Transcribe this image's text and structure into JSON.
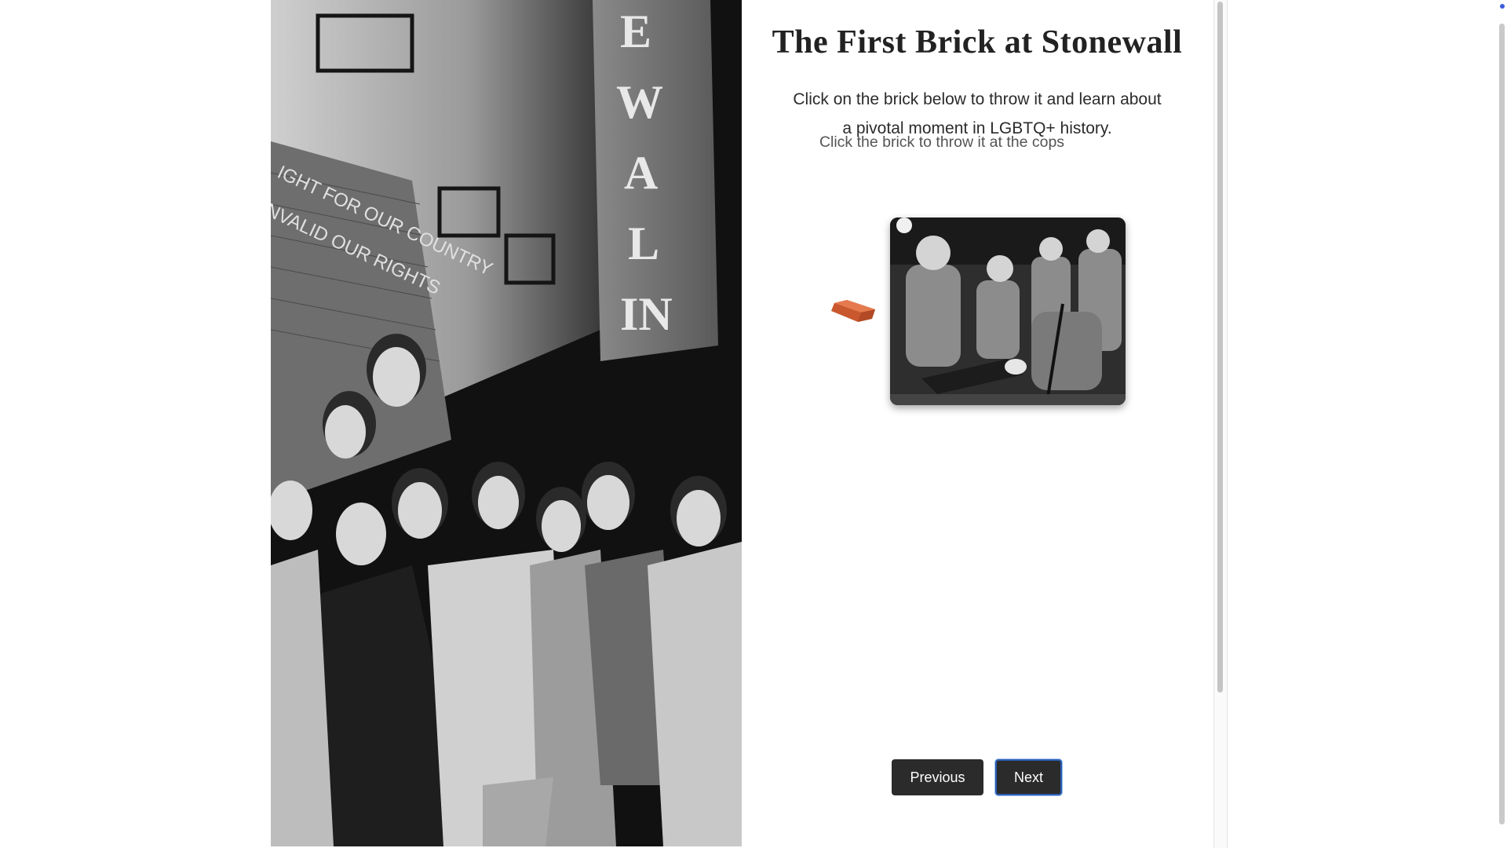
{
  "page": {
    "title": "The First Brick at Stonewall",
    "instructions": "Click on the brick below to throw it and learn about a pivotal moment in LGBTQ+ history.",
    "hint": "Click the brick to throw it at the cops"
  },
  "images": {
    "hero_icon": "stonewall-inn-crowd-photo",
    "brick_icon": "brick-icon",
    "target_icon": "police-line-photo"
  },
  "navigation": {
    "previous_label": "Previous",
    "next_label": "Next"
  },
  "colors": {
    "brick": "#d9653b",
    "button_bg": "#2b2b2b",
    "focus_ring": "#2a5db0"
  }
}
